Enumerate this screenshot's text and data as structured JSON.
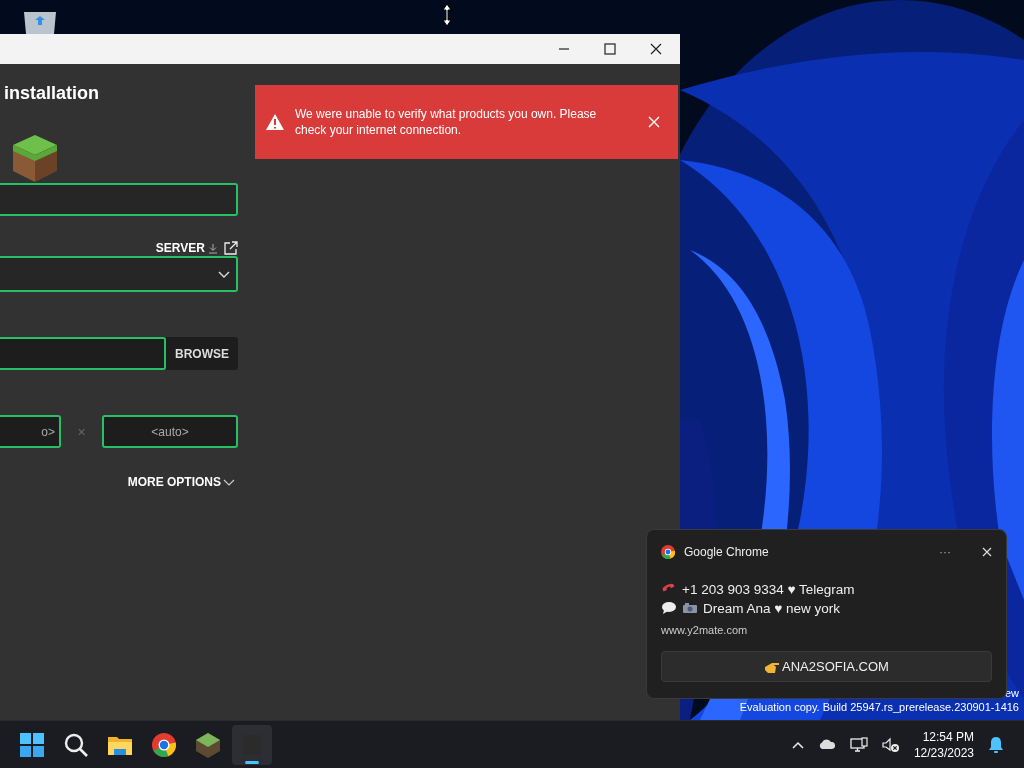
{
  "desktop": {
    "watermark_lines": [
      "ew",
      "Evaluation copy. Build 25947.rs_prerelease.230901-1416"
    ]
  },
  "window": {
    "heading": "installation",
    "server_link": "SERVER",
    "browse_button": "BROWSE",
    "resolution": {
      "width_placeholder": "o>",
      "separator": "×",
      "height_placeholder": "<auto>"
    },
    "more_options": "MORE OPTIONS"
  },
  "error_banner": {
    "message": "We were unable to verify what products you own. Please check your internet connection."
  },
  "notification": {
    "app": "Google Chrome",
    "more": "···",
    "lines": [
      {
        "kind": "phone",
        "text": "+1 203 903 9334 ♥ Telegram"
      },
      {
        "kind": "chat",
        "text": "Dream Ana ♥ new york"
      }
    ],
    "source": "www.y2mate.com",
    "action": "ANA2SOFIA.COM"
  },
  "taskbar": {
    "apps": [
      {
        "kind": "start",
        "active": false
      },
      {
        "kind": "search",
        "active": false
      },
      {
        "kind": "folder",
        "active": false
      },
      {
        "kind": "chrome",
        "active": false
      },
      {
        "kind": "cube",
        "active": false
      },
      {
        "kind": "blank",
        "active": true
      }
    ],
    "time": "12:54 PM",
    "date": "12/23/2023"
  }
}
